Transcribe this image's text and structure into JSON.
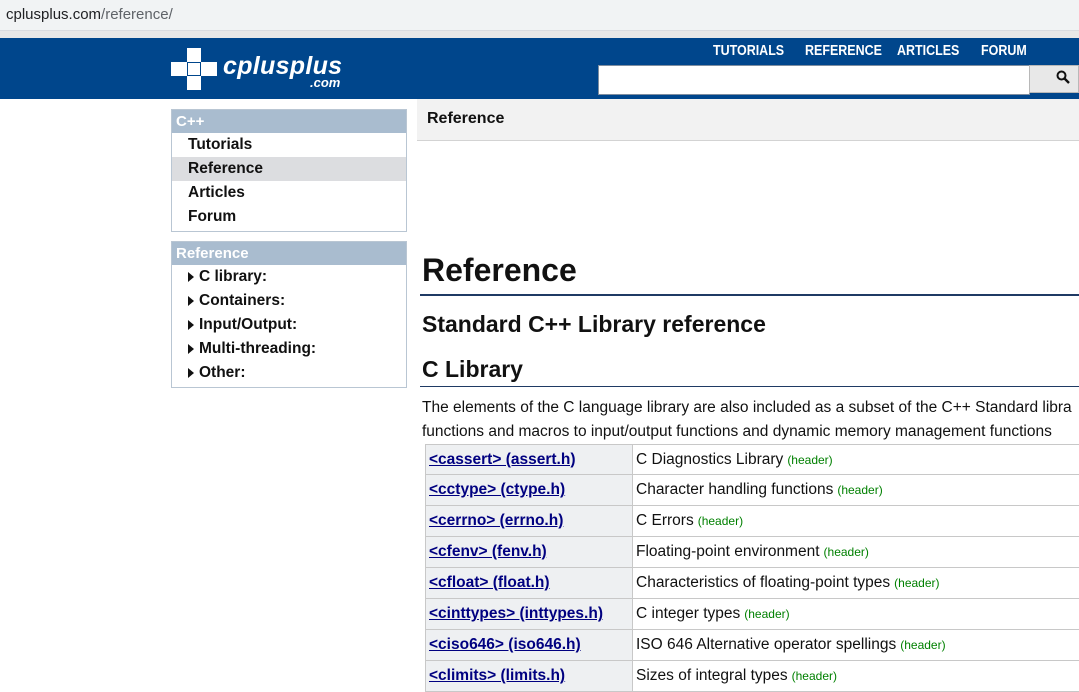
{
  "browser": {
    "url_host": "cplusplus.com",
    "url_path": "/reference/"
  },
  "site": {
    "logo_text": "cplusplus",
    "logo_sub": ".com"
  },
  "topnav": [
    "TUTORIALS",
    "REFERENCE",
    "ARTICLES",
    "FORUM"
  ],
  "search": {
    "placeholder": "",
    "button_icon": "search-icon"
  },
  "sidebar": {
    "cpp_box": {
      "title": "C++",
      "items": [
        "Tutorials",
        "Reference",
        "Articles",
        "Forum"
      ],
      "selected": "Reference"
    },
    "ref_box": {
      "title": "Reference",
      "items": [
        "C library:",
        "Containers:",
        "Input/Output:",
        "Multi-threading:",
        "Other:"
      ]
    }
  },
  "breadcrumb": "Reference",
  "main": {
    "title": "Reference",
    "subtitle": "Standard C++ Library reference",
    "section": "C Library",
    "intro_line1": "The elements of the C language library are also included as a subset of the C++ Standard libra",
    "intro_line2": "functions and macros to input/output functions and dynamic memory management functions"
  },
  "c_library": [
    {
      "name": "<cassert> (assert.h)",
      "desc": "C Diagnostics Library",
      "tag": "(header)"
    },
    {
      "name": "<cctype> (ctype.h)",
      "desc": "Character handling functions",
      "tag": "(header)"
    },
    {
      "name": "<cerrno> (errno.h)",
      "desc": "C Errors",
      "tag": "(header)"
    },
    {
      "name": "<cfenv> (fenv.h)",
      "desc": "Floating-point environment",
      "tag": "(header)"
    },
    {
      "name": "<cfloat> (float.h)",
      "desc": "Characteristics of floating-point types",
      "tag": "(header)"
    },
    {
      "name": "<cinttypes> (inttypes.h)",
      "desc": "C integer types",
      "tag": "(header)"
    },
    {
      "name": "<ciso646> (iso646.h)",
      "desc": "ISO 646 Alternative operator spellings",
      "tag": "(header)"
    },
    {
      "name": "<climits> (limits.h)",
      "desc": "Sizes of integral types",
      "tag": "(header)"
    }
  ],
  "colors": {
    "header_bg": "#00468c",
    "sidebar_head": "#a9bccf",
    "link": "#000080",
    "tag": "#008000"
  }
}
